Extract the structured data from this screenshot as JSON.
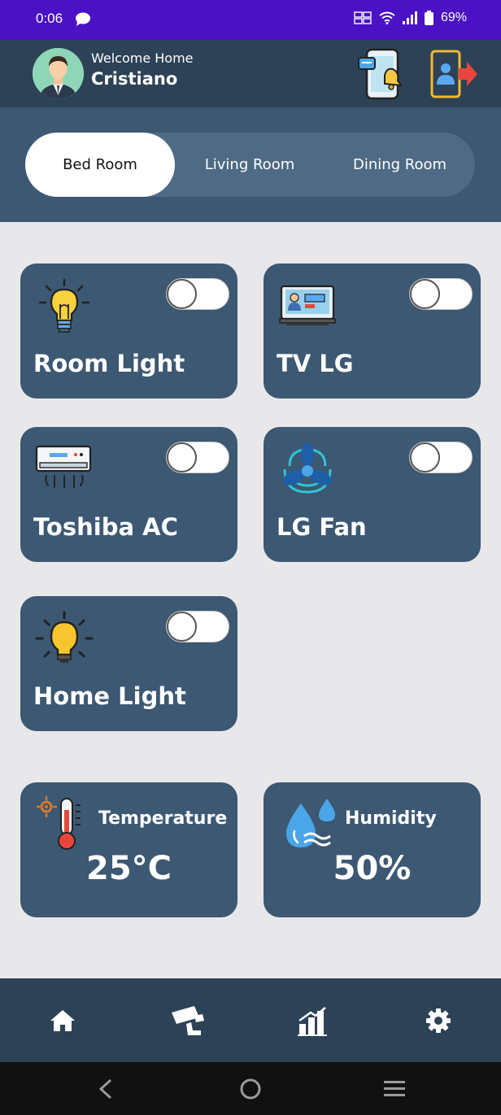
{
  "status_bar": {
    "time": "0:06",
    "battery": "69%"
  },
  "header": {
    "welcome": "Welcome Home",
    "user_name": "Cristiano"
  },
  "tabs": [
    {
      "label": "Bed Room",
      "active": true
    },
    {
      "label": "Living Room",
      "active": false
    },
    {
      "label": "Dining Room",
      "active": false
    }
  ],
  "devices": [
    {
      "name": "Room Light",
      "icon": "bulb-icon",
      "on": false
    },
    {
      "name": "TV LG",
      "icon": "tv-icon",
      "on": false
    },
    {
      "name": "Toshiba AC",
      "icon": "ac-icon",
      "on": false
    },
    {
      "name": "LG Fan",
      "icon": "fan-icon",
      "on": false
    },
    {
      "name": "Home Light",
      "icon": "light-icon",
      "on": false
    }
  ],
  "sensors": {
    "temperature": {
      "title": "Temperature",
      "value": "25°C",
      "icon": "thermometer-icon"
    },
    "humidity": {
      "title": "Humidity",
      "value": "50%",
      "icon": "water-drop-icon"
    }
  },
  "bottom_nav": [
    "home-icon",
    "cctv-icon",
    "chart-icon",
    "settings-icon"
  ],
  "colors": {
    "status_bar": "#4a12c4",
    "header": "#2d4256",
    "card": "#3c5872",
    "background": "#e8e8ea"
  }
}
